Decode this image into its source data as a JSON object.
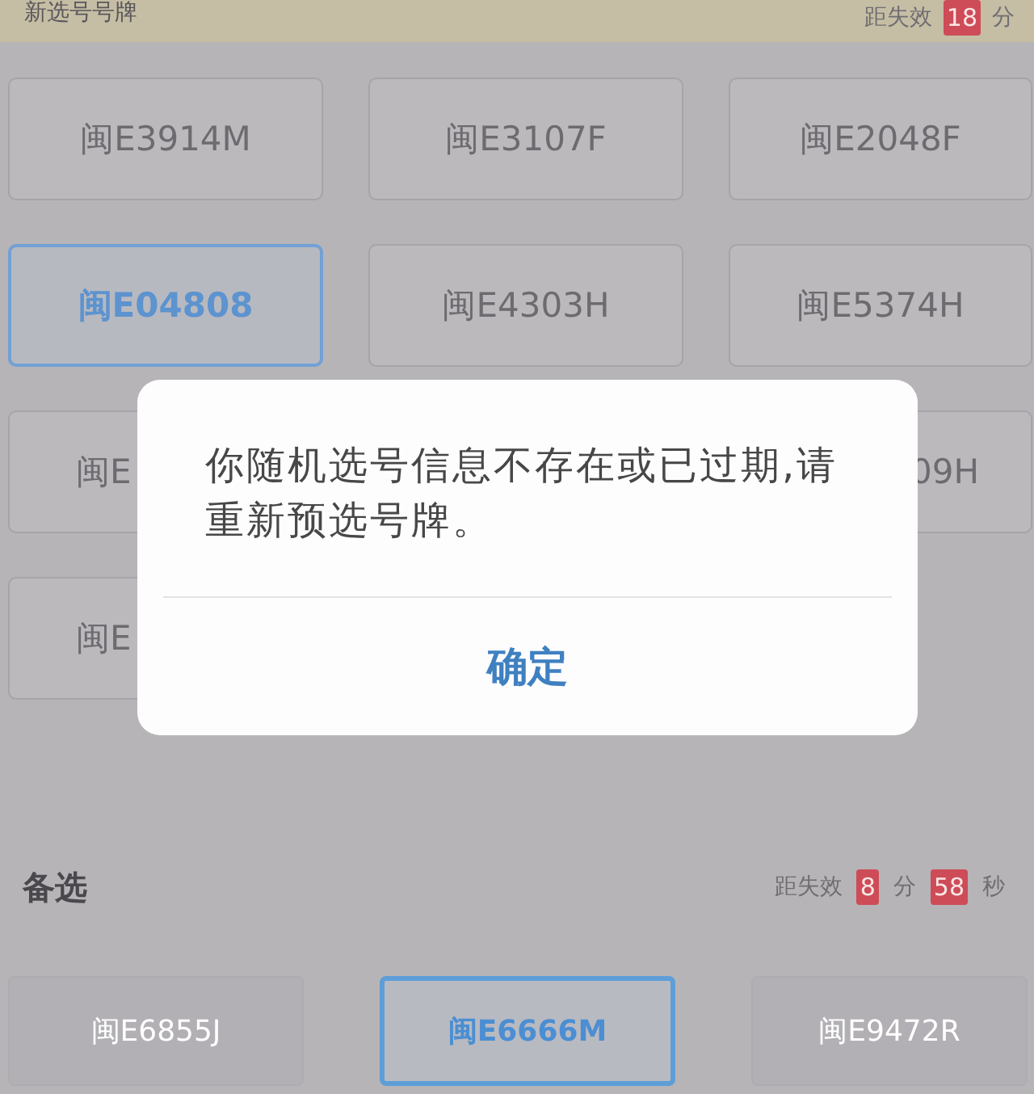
{
  "header": {
    "title": "新选号号牌",
    "timer": {
      "label": "距失效",
      "minutes": "18",
      "minutes_unit": "分"
    }
  },
  "plates": [
    {
      "text": "闽E3914M",
      "kind": "whole",
      "selected": false
    },
    {
      "text": "闽E3107F",
      "kind": "whole",
      "selected": false
    },
    {
      "text": "闽E2048F",
      "kind": "whole",
      "selected": false
    },
    {
      "text": "闽E04808",
      "kind": "whole",
      "selected": true
    },
    {
      "text": "闽E4303H",
      "kind": "whole",
      "selected": false
    },
    {
      "text": "闽E5374H",
      "kind": "whole",
      "selected": false
    },
    {
      "text": "闽E",
      "kind": "head",
      "selected": false
    },
    {
      "text": "09H",
      "kind": "tail",
      "selected": false
    },
    {
      "text": "闽E",
      "kind": "head",
      "selected": false
    }
  ],
  "dialog": {
    "message": "你随机选号信息不存在或已过期,请重新预选号牌。",
    "button": "确定"
  },
  "backup": {
    "title": "备选",
    "timer": {
      "label": "距失效",
      "minutes": "8",
      "minutes_unit": "分",
      "seconds": "58",
      "seconds_unit": "秒"
    },
    "plates": [
      {
        "text": "闽E6855J",
        "selected": false,
        "disabled": true
      },
      {
        "text": "闽E6666M",
        "selected": true,
        "disabled": false
      },
      {
        "text": "闽E9472R",
        "selected": false,
        "disabled": true
      }
    ]
  }
}
